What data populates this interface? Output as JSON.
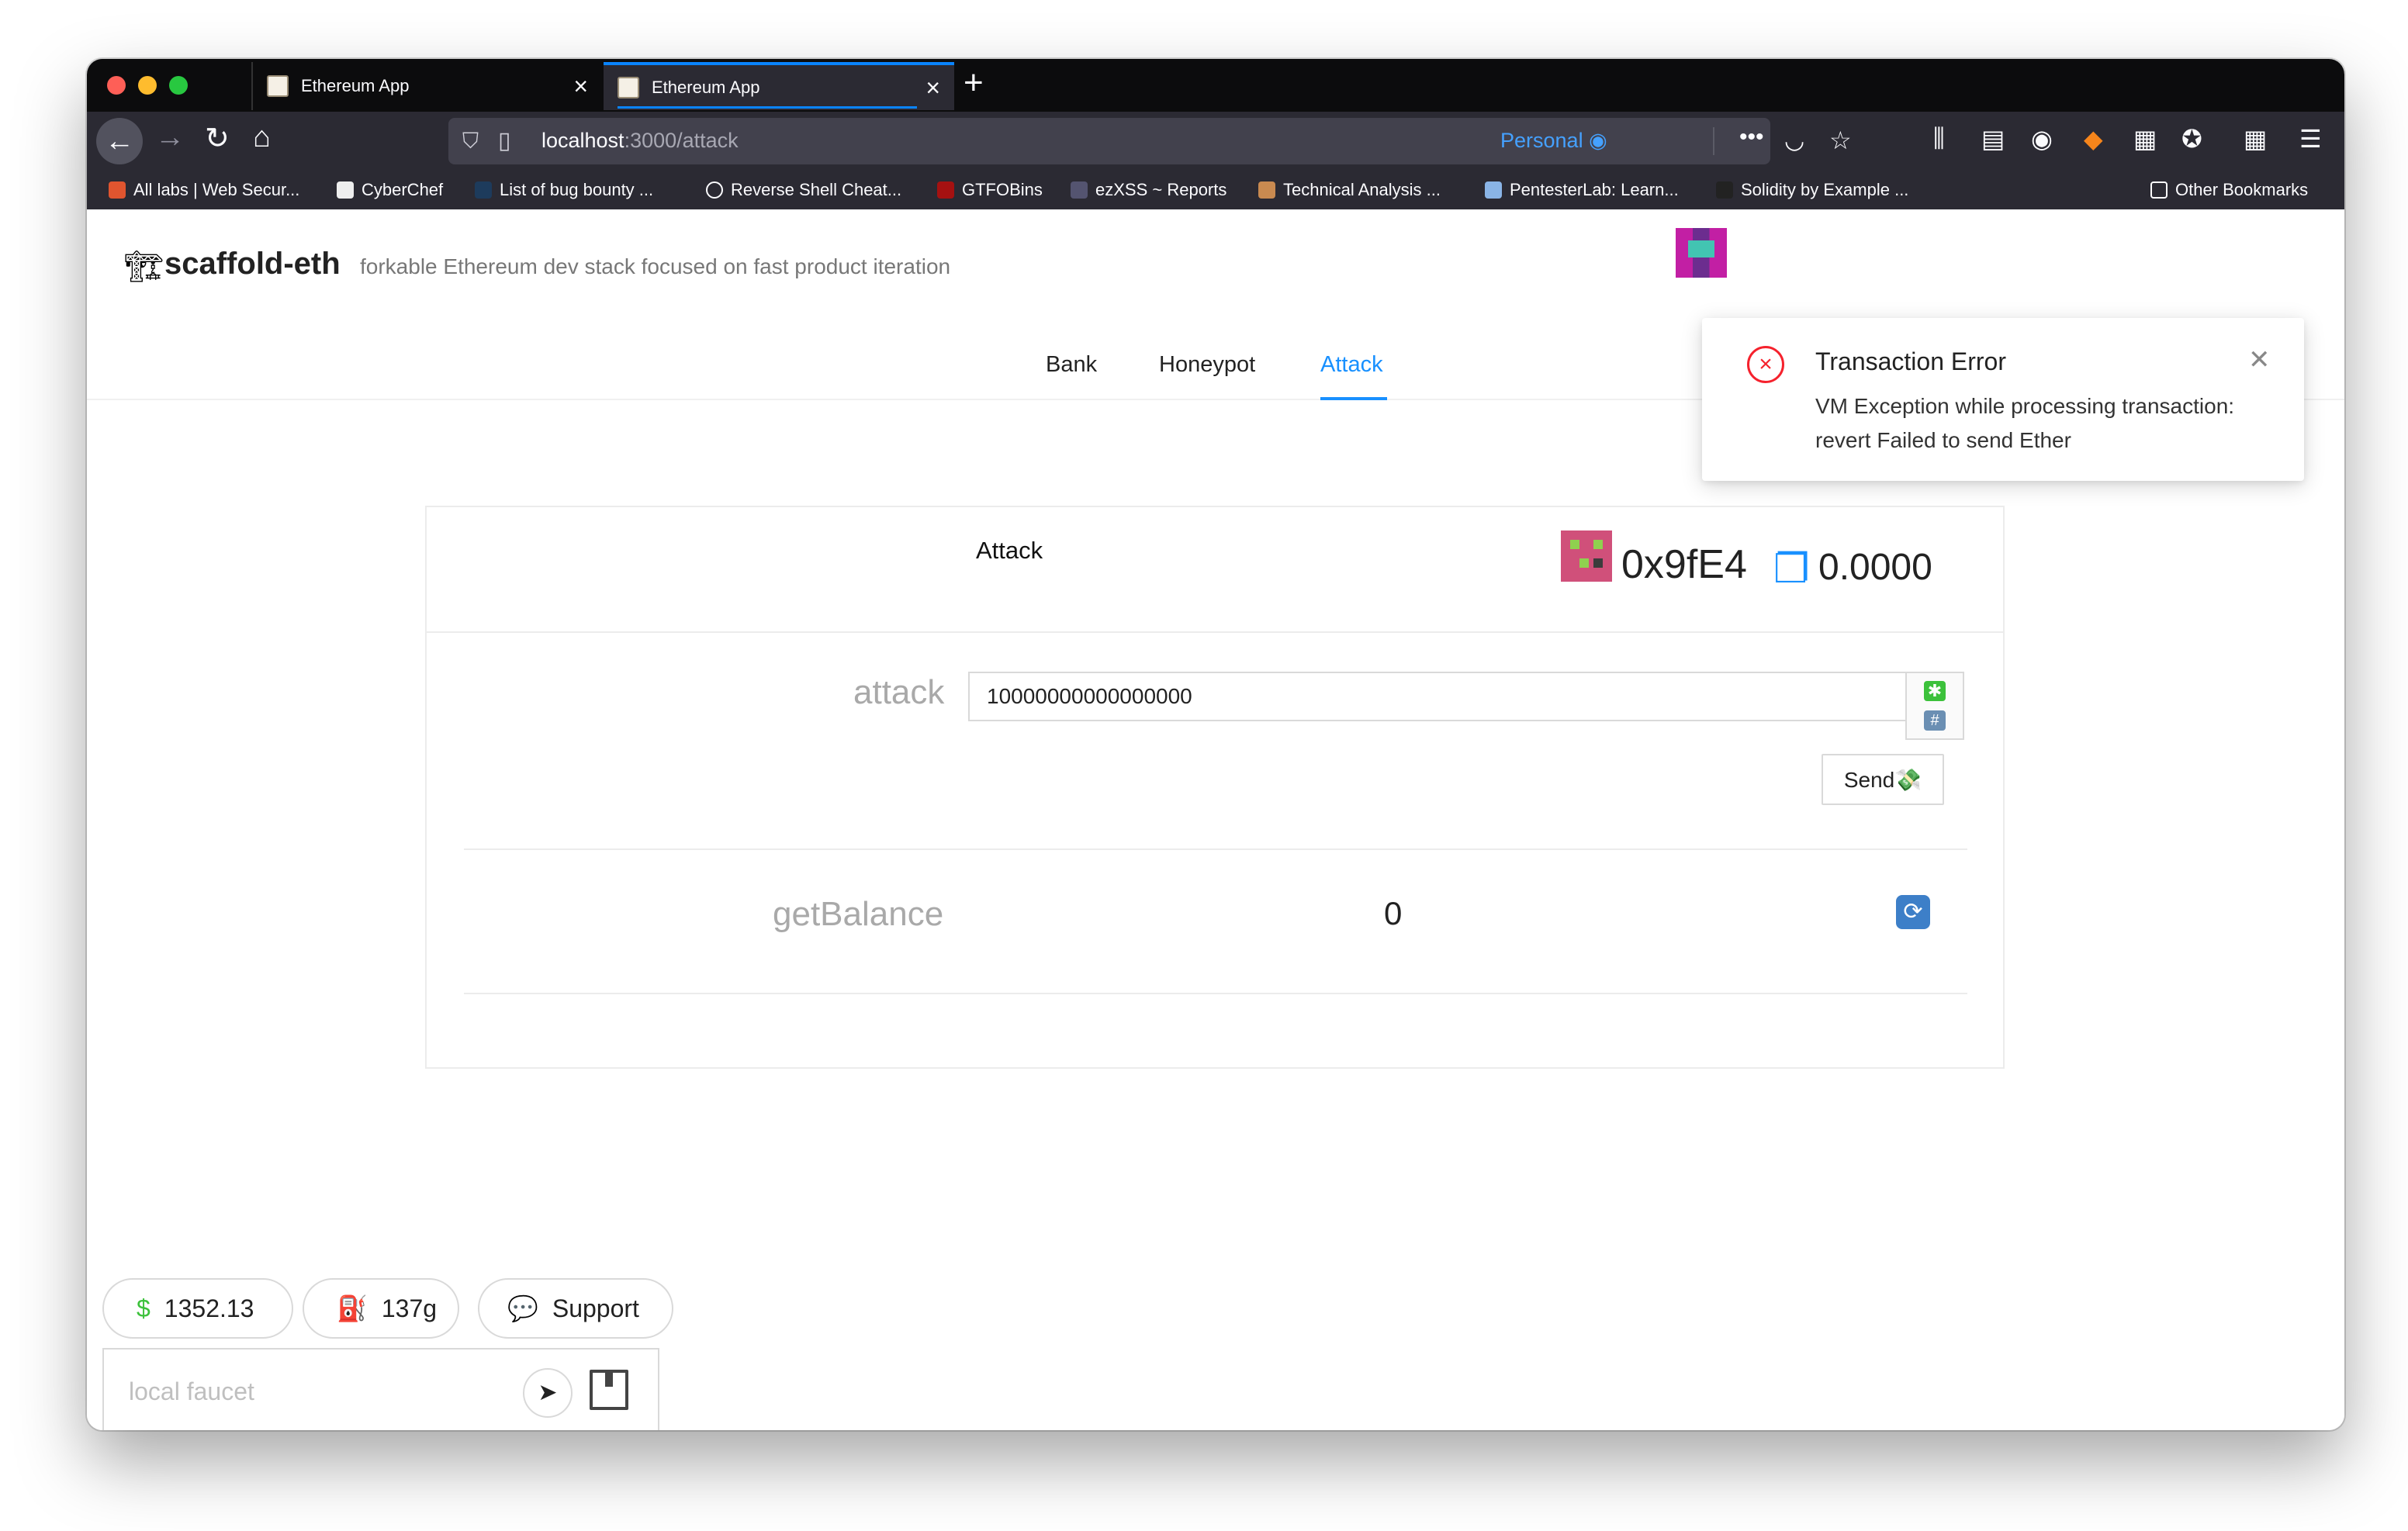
{
  "browser": {
    "tabs": [
      {
        "title": "Ethereum App"
      },
      {
        "title": "Ethereum App"
      }
    ],
    "url": {
      "host": "localhost",
      "path": ":3000/attack"
    },
    "container": "Personal",
    "bookmarks": [
      "All labs | Web Secur...",
      "CyberChef",
      "List of bug bounty ...",
      "Reverse Shell Cheat...",
      "GTFOBins",
      "ezXSS ~ Reports",
      "Technical Analysis ...",
      "PentesterLab: Learn...",
      "Solidity by Example ...",
      "Other Bookmarks"
    ]
  },
  "header": {
    "title": "scaffold-eth",
    "subtitle": "forkable Ethereum dev stack focused on fast product iteration"
  },
  "menu": {
    "items": [
      "Bank",
      "Honeypot",
      "Attack"
    ],
    "active": "Attack"
  },
  "contract": {
    "title": "Attack",
    "address": "0x9fE4",
    "balance": "0.0000",
    "functions": {
      "attack": {
        "label": "attack",
        "value": "10000000000000000",
        "button": "Send💸"
      },
      "getBalance": {
        "label": "getBalance",
        "value": "0"
      }
    }
  },
  "footer": {
    "price": "1352.13",
    "gas": "137g",
    "support": "Support",
    "faucet_placeholder": "local faucet"
  },
  "notification": {
    "title": "Transaction Error",
    "description": "VM Exception while processing transaction: revert Failed to send Ether"
  },
  "colors": {
    "accent": "#1890ff",
    "error": "#f5222d"
  }
}
